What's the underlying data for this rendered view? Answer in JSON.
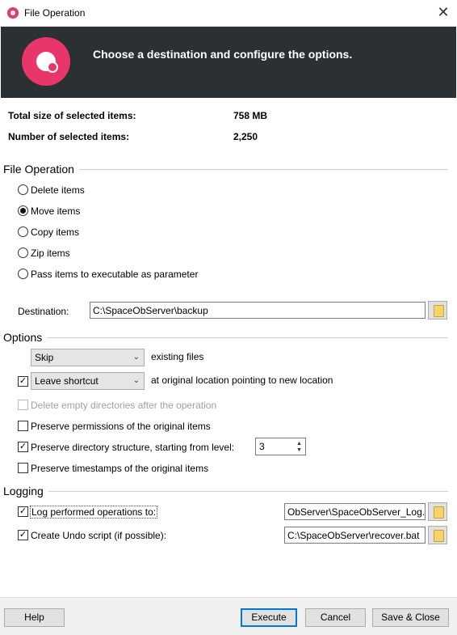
{
  "window": {
    "title": "File Operation",
    "close_label": "✕"
  },
  "banner": {
    "text": "Choose a destination and configure the options."
  },
  "summary": {
    "total_size_label": "Total size of selected items:",
    "total_size_value": "758 MB",
    "count_label": "Number of selected items:",
    "count_value": "2,250"
  },
  "file_operation": {
    "title": "File Operation",
    "options": [
      {
        "label": "Delete items",
        "selected": false
      },
      {
        "label": "Move items",
        "selected": true
      },
      {
        "label": "Copy items",
        "selected": false
      },
      {
        "label": "Zip items",
        "selected": false
      },
      {
        "label": "Pass items to executable as parameter",
        "selected": false
      }
    ],
    "destination_label": "Destination:",
    "destination_value": "C:\\SpaceObServer\\backup"
  },
  "options": {
    "title": "Options",
    "existing_combo": "Skip",
    "existing_suffix": "existing files",
    "shortcut_checked": true,
    "shortcut_combo": "Leave shortcut",
    "shortcut_suffix": "at original location pointing to new location",
    "delete_empty": {
      "label": "Delete empty directories after the operation",
      "checked": false,
      "enabled": false
    },
    "preserve_permissions": {
      "label": "Preserve permissions of the original items",
      "checked": false
    },
    "preserve_structure": {
      "label": "Preserve directory structure, starting from level:",
      "checked": true,
      "level": "3"
    },
    "preserve_timestamps": {
      "label": "Preserve timestamps of the original items",
      "checked": false
    }
  },
  "logging": {
    "title": "Logging",
    "log_ops": {
      "label": "Log performed operations to:",
      "checked": true,
      "value": "ObServer\\SpaceObServer_Log.txt"
    },
    "undo": {
      "label": "Create Undo script (if possible):",
      "checked": true,
      "value": "C:\\SpaceObServer\\recover.bat"
    }
  },
  "footer": {
    "help": "Help",
    "execute": "Execute",
    "cancel": "Cancel",
    "save_close": "Save & Close"
  },
  "colors": {
    "brand": "#e8366b",
    "banner_bg": "#2b3033",
    "accent": "#0078d7"
  },
  "icons": {
    "app": "app-logo-icon",
    "folder": "folder-icon",
    "close": "close-icon"
  }
}
